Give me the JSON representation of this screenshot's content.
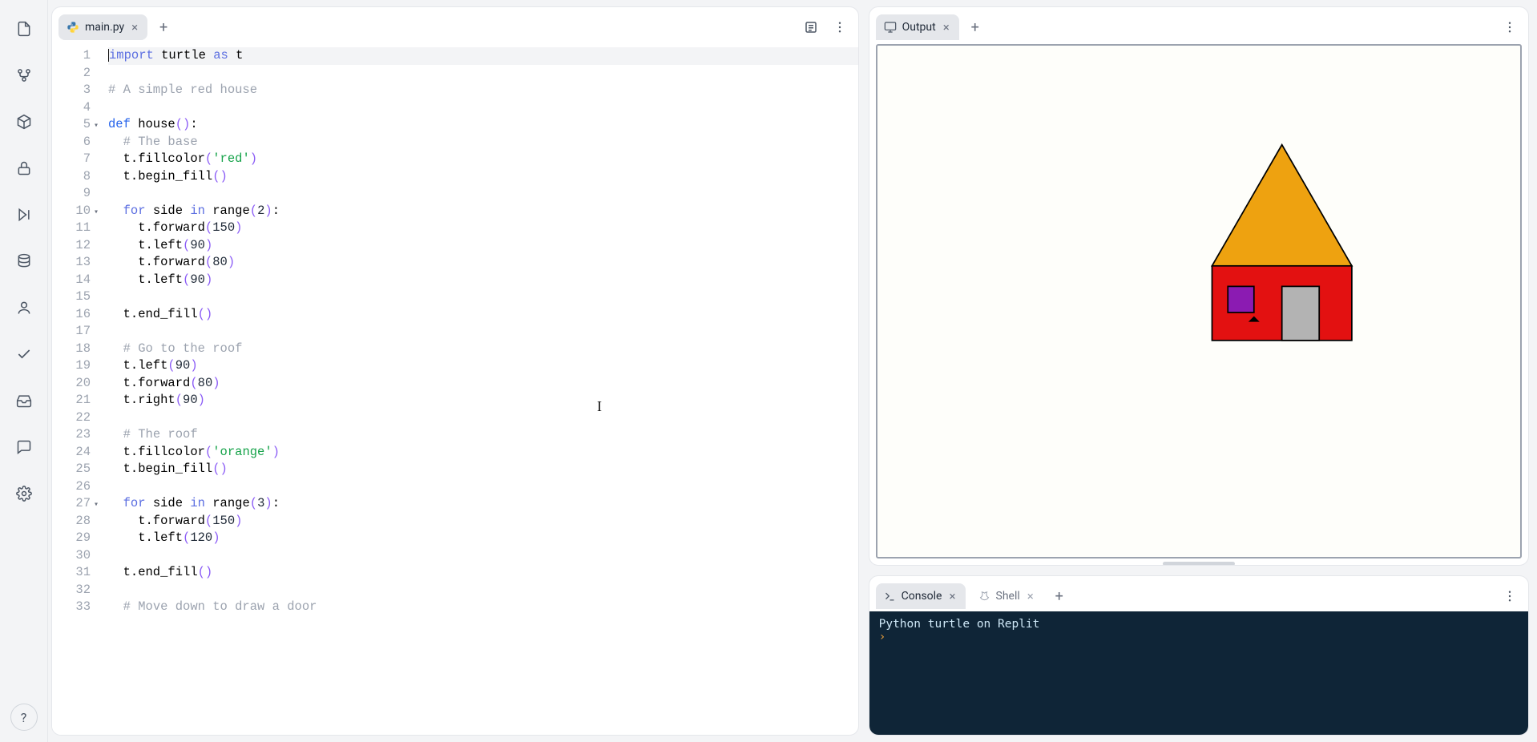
{
  "sidebar": {
    "icons": [
      "file-icon",
      "branch-icon",
      "package-icon",
      "lock-icon",
      "play-skip-icon",
      "database-icon",
      "user-icon",
      "check-icon",
      "inbox-icon",
      "chat-icon",
      "settings-icon"
    ],
    "help_label": "?"
  },
  "editor": {
    "tab": {
      "filename": "main.py"
    },
    "lines": [
      {
        "n": 1,
        "fold": "",
        "hl": true,
        "segs": [
          [
            "kw",
            "import"
          ],
          [
            "",
            " turtle "
          ],
          [
            "kw",
            "as"
          ],
          [
            "",
            " t"
          ]
        ]
      },
      {
        "n": 2,
        "fold": "",
        "segs": [
          [
            "",
            ""
          ]
        ]
      },
      {
        "n": 3,
        "fold": "",
        "segs": [
          [
            "com",
            "# A simple red house"
          ]
        ]
      },
      {
        "n": 4,
        "fold": "",
        "segs": [
          [
            "",
            ""
          ]
        ]
      },
      {
        "n": 5,
        "fold": "▾",
        "segs": [
          [
            "kw2",
            "def"
          ],
          [
            "",
            " house"
          ],
          [
            "br",
            "()"
          ],
          [
            "",
            ":"
          ]
        ]
      },
      {
        "n": 6,
        "fold": "",
        "segs": [
          [
            "",
            "  "
          ],
          [
            "com",
            "# The base"
          ]
        ]
      },
      {
        "n": 7,
        "fold": "",
        "segs": [
          [
            "",
            "  t.fillcolor"
          ],
          [
            "br",
            "("
          ],
          [
            "str",
            "'red'"
          ],
          [
            "br",
            ")"
          ]
        ]
      },
      {
        "n": 8,
        "fold": "",
        "segs": [
          [
            "",
            "  t.begin_fill"
          ],
          [
            "br",
            "()"
          ]
        ]
      },
      {
        "n": 9,
        "fold": "",
        "segs": [
          [
            "",
            ""
          ]
        ]
      },
      {
        "n": 10,
        "fold": "▾",
        "segs": [
          [
            "",
            "  "
          ],
          [
            "kw",
            "for"
          ],
          [
            "",
            " side "
          ],
          [
            "kw",
            "in"
          ],
          [
            "",
            " range"
          ],
          [
            "br",
            "("
          ],
          [
            "num",
            "2"
          ],
          [
            "br",
            ")"
          ],
          [
            "",
            ":"
          ]
        ]
      },
      {
        "n": 11,
        "fold": "",
        "segs": [
          [
            "",
            "    t.forward"
          ],
          [
            "br",
            "("
          ],
          [
            "num",
            "150"
          ],
          [
            "br",
            ")"
          ]
        ]
      },
      {
        "n": 12,
        "fold": "",
        "segs": [
          [
            "",
            "    t.left"
          ],
          [
            "br",
            "("
          ],
          [
            "num",
            "90"
          ],
          [
            "br",
            ")"
          ]
        ]
      },
      {
        "n": 13,
        "fold": "",
        "segs": [
          [
            "",
            "    t.forward"
          ],
          [
            "br",
            "("
          ],
          [
            "num",
            "80"
          ],
          [
            "br",
            ")"
          ]
        ]
      },
      {
        "n": 14,
        "fold": "",
        "segs": [
          [
            "",
            "    t.left"
          ],
          [
            "br",
            "("
          ],
          [
            "num",
            "90"
          ],
          [
            "br",
            ")"
          ]
        ]
      },
      {
        "n": 15,
        "fold": "",
        "segs": [
          [
            "",
            ""
          ]
        ]
      },
      {
        "n": 16,
        "fold": "",
        "segs": [
          [
            "",
            "  t.end_fill"
          ],
          [
            "br",
            "()"
          ]
        ]
      },
      {
        "n": 17,
        "fold": "",
        "segs": [
          [
            "",
            ""
          ]
        ]
      },
      {
        "n": 18,
        "fold": "",
        "segs": [
          [
            "",
            "  "
          ],
          [
            "com",
            "# Go to the roof"
          ]
        ]
      },
      {
        "n": 19,
        "fold": "",
        "segs": [
          [
            "",
            "  t.left"
          ],
          [
            "br",
            "("
          ],
          [
            "num",
            "90"
          ],
          [
            "br",
            ")"
          ]
        ]
      },
      {
        "n": 20,
        "fold": "",
        "segs": [
          [
            "",
            "  t.forward"
          ],
          [
            "br",
            "("
          ],
          [
            "num",
            "80"
          ],
          [
            "br",
            ")"
          ]
        ]
      },
      {
        "n": 21,
        "fold": "",
        "segs": [
          [
            "",
            "  t.right"
          ],
          [
            "br",
            "("
          ],
          [
            "num",
            "90"
          ],
          [
            "br",
            ")"
          ]
        ]
      },
      {
        "n": 22,
        "fold": "",
        "segs": [
          [
            "",
            ""
          ]
        ]
      },
      {
        "n": 23,
        "fold": "",
        "segs": [
          [
            "",
            "  "
          ],
          [
            "com",
            "# The roof"
          ]
        ]
      },
      {
        "n": 24,
        "fold": "",
        "segs": [
          [
            "",
            "  t.fillcolor"
          ],
          [
            "br",
            "("
          ],
          [
            "str",
            "'orange'"
          ],
          [
            "br",
            ")"
          ]
        ]
      },
      {
        "n": 25,
        "fold": "",
        "segs": [
          [
            "",
            "  t.begin_fill"
          ],
          [
            "br",
            "()"
          ]
        ]
      },
      {
        "n": 26,
        "fold": "",
        "segs": [
          [
            "",
            ""
          ]
        ]
      },
      {
        "n": 27,
        "fold": "▾",
        "segs": [
          [
            "",
            "  "
          ],
          [
            "kw",
            "for"
          ],
          [
            "",
            " side "
          ],
          [
            "kw",
            "in"
          ],
          [
            "",
            " range"
          ],
          [
            "br",
            "("
          ],
          [
            "num",
            "3"
          ],
          [
            "br",
            ")"
          ],
          [
            "",
            ":"
          ]
        ]
      },
      {
        "n": 28,
        "fold": "",
        "segs": [
          [
            "",
            "    t.forward"
          ],
          [
            "br",
            "("
          ],
          [
            "num",
            "150"
          ],
          [
            "br",
            ")"
          ]
        ]
      },
      {
        "n": 29,
        "fold": "",
        "segs": [
          [
            "",
            "    t.left"
          ],
          [
            "br",
            "("
          ],
          [
            "num",
            "120"
          ],
          [
            "br",
            ")"
          ]
        ]
      },
      {
        "n": 30,
        "fold": "",
        "segs": [
          [
            "",
            ""
          ]
        ]
      },
      {
        "n": 31,
        "fold": "",
        "segs": [
          [
            "",
            "  t.end_fill"
          ],
          [
            "br",
            "()"
          ]
        ]
      },
      {
        "n": 32,
        "fold": "",
        "segs": [
          [
            "",
            ""
          ]
        ]
      },
      {
        "n": 33,
        "fold": "",
        "segs": [
          [
            "",
            "  "
          ],
          [
            "com",
            "# Move down to draw a door"
          ]
        ]
      }
    ]
  },
  "output": {
    "tab_label": "Output",
    "house": {
      "base_color": "#e31111",
      "roof_color": "#eea210",
      "door_color": "#b3b3b3",
      "window_color": "#8b1bb2",
      "stroke": "#000000"
    }
  },
  "console": {
    "tabs": [
      {
        "label": "Console",
        "active": true
      },
      {
        "label": "Shell",
        "active": false
      }
    ],
    "lines": [
      "Python turtle on Replit"
    ],
    "prompt": "›"
  }
}
